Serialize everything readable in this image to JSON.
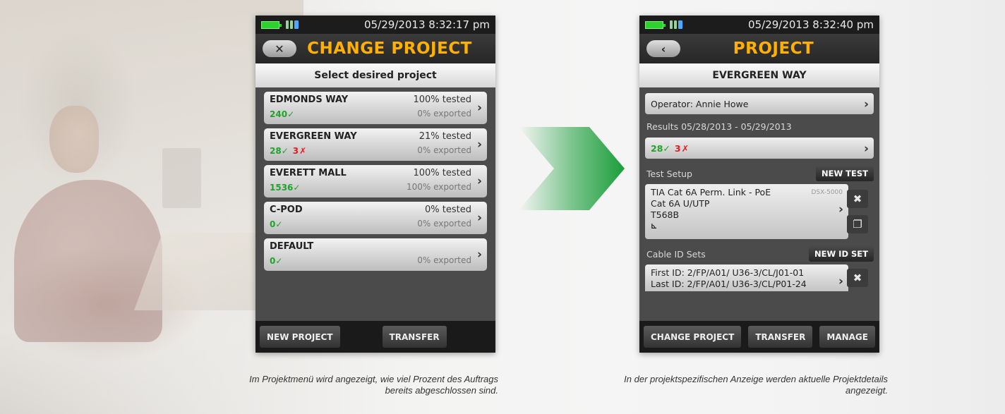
{
  "left_screen": {
    "status_time": "05/29/2013 8:32:17 pm",
    "title": "CHANGE PROJECT",
    "subheader": "Select desired project",
    "projects": [
      {
        "name": "EDMONDS WAY",
        "tested": "100% tested",
        "exported": "0% exported",
        "pass": "240",
        "fail": ""
      },
      {
        "name": "EVERGREEN WAY",
        "tested": "21% tested",
        "exported": "0% exported",
        "pass": "28",
        "fail": "3"
      },
      {
        "name": "EVERETT MALL",
        "tested": "100% tested",
        "exported": "100% exported",
        "pass": "1536",
        "fail": ""
      },
      {
        "name": "C-POD",
        "tested": "0% tested",
        "exported": "0% exported",
        "pass": "0",
        "fail": ""
      },
      {
        "name": "DEFAULT",
        "tested": "",
        "exported": "0% exported",
        "pass": "0",
        "fail": ""
      }
    ],
    "buttons": {
      "new_project": "NEW PROJECT",
      "transfer": "TRANSFER"
    }
  },
  "right_screen": {
    "status_time": "05/29/2013 8:32:40 pm",
    "title": "PROJECT",
    "subheader": "EVERGREEN WAY",
    "operator": "Operator: Annie Howe",
    "results_label": "Results 05/28/2013 - 05/29/2013",
    "results": {
      "pass": "28",
      "fail": "3"
    },
    "test_setup_label": "Test Setup",
    "new_test": "NEW TEST",
    "setup": {
      "line1": "TIA Cat 6A Perm. Link - PoE",
      "line2": "Cat 6A U/UTP",
      "line3": "T568B",
      "tag": "DSX-5000"
    },
    "cable_id_label": "Cable ID Sets",
    "new_id_set": "NEW ID SET",
    "first_id": "First ID: 2/FP/A01/ U36-3/CL/J01-01",
    "last_id": "Last ID: 2/FP/A01/ U36-3/CL/P01-24",
    "buttons": {
      "change_project": "CHANGE PROJECT",
      "transfer": "TRANSFER",
      "manage": "MANAGE"
    }
  },
  "captions": {
    "left": "Im Projektmenü wird angezeigt, wie viel Prozent des Auftrags bereits abgeschlossen sind.",
    "right": "In der projektspezifischen Anzeige werden aktuelle Projektdetails angezeigt."
  },
  "colors": {
    "title": "#ffb000",
    "pass": "#1fa32a",
    "fail": "#e01d1d",
    "arrow": "#1a9e3a"
  }
}
